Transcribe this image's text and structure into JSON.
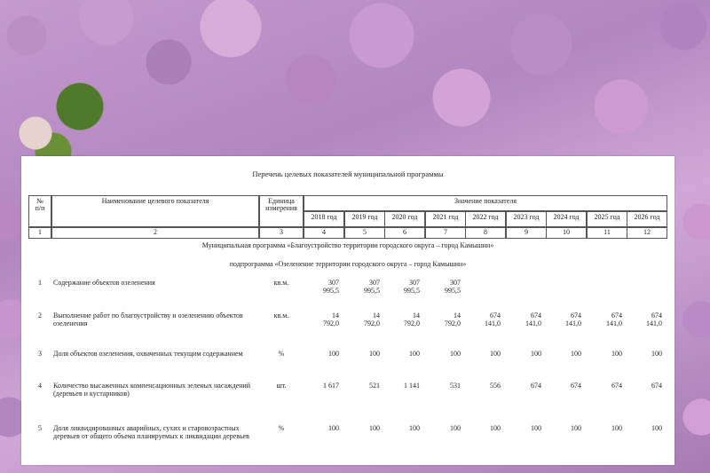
{
  "document": {
    "title": "Перечень целевых показателей муниципальной программы",
    "headers": {
      "number": "№\nп/п",
      "name": "Наименование целевого показателя",
      "unit": "Единица\nизмерения",
      "value_group": "Значение показателя",
      "years": [
        "2018 год",
        "2019 год",
        "2020 год",
        "2021 год",
        "2022 год",
        "2023 год",
        "2024 год",
        "2025 год",
        "2026 год"
      ]
    },
    "column_numbers": [
      "1",
      "2",
      "3",
      "4",
      "5",
      "6",
      "7",
      "8",
      "9",
      "10",
      "11",
      "12"
    ],
    "program_title": "Муниципальная программа «Благоустройство территории городского округа – город Камышин»",
    "subprogram_title": "подпрограмма «Озеленение территории городского округа – город Камышин»",
    "rows": [
      {
        "n": "1",
        "name": "Содержание объектов озеленения",
        "unit": "кв.м.",
        "values": [
          "307\n995,5",
          "307\n995,5",
          "307\n995,5",
          "307\n995,5",
          "",
          "",
          "",
          "",
          ""
        ]
      },
      {
        "n": "2",
        "name": "Выполнение работ по благоустройству и озеленению объектов озеленения",
        "unit": "кв.м.",
        "values": [
          "14\n792,0",
          "14\n792,0",
          "14\n792,0",
          "14\n792,0",
          "674\n141,0",
          "674\n141,0",
          "674\n141,0",
          "674\n141,0",
          "674\n141,0"
        ]
      },
      {
        "n": "3",
        "name": "Доля объектов озеленения, охваченных текущим содержанием",
        "unit": "%",
        "values": [
          "100",
          "100",
          "100",
          "100",
          "100",
          "100",
          "100",
          "100",
          "100"
        ]
      },
      {
        "n": "4",
        "name": "Количество высаженных компенсационных зеленых насаждений (деревьев и кустарников)",
        "unit": "шт.",
        "values": [
          "1 617",
          "521",
          "1 141",
          "531",
          "556",
          "674",
          "674",
          "674",
          "674"
        ]
      },
      {
        "n": "5",
        "name": "Доля ликвидированных аварийных, сухих и старовозрастных деревьев от общего объема планируемых к ликвидации деревьев",
        "unit": "%",
        "values": [
          "100",
          "100",
          "100",
          "100",
          "100",
          "100",
          "100",
          "100",
          "100"
        ]
      }
    ]
  }
}
